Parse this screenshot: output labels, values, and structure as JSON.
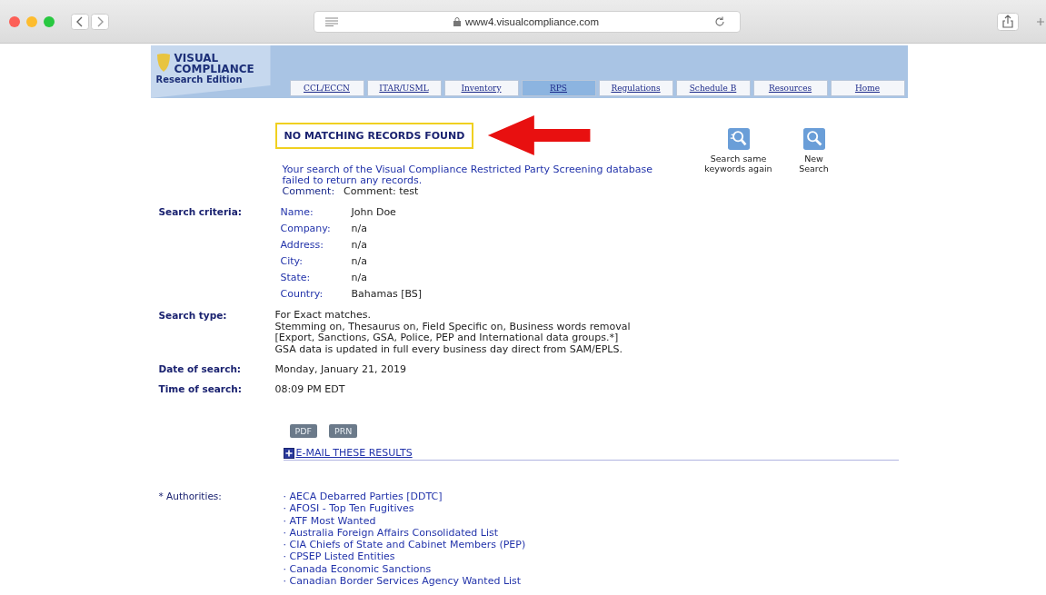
{
  "browser": {
    "url": "www4.visualcompliance.com"
  },
  "logo": {
    "line_1": "VISUAL",
    "line_2": "COMPLIANCE",
    "edition": "Research Edition"
  },
  "tabs": [
    {
      "label": "CCL/ECCN",
      "selected": false
    },
    {
      "label": "ITAR/USML",
      "selected": false
    },
    {
      "label": "Inventory",
      "selected": false
    },
    {
      "label": "RPS",
      "selected": true
    },
    {
      "label": "Regulations",
      "selected": false
    },
    {
      "label": "Schedule B",
      "selected": false
    },
    {
      "label": "Resources",
      "selected": false
    },
    {
      "label": "Home",
      "selected": false
    }
  ],
  "result_banner": "NO MATCHING RECORDS FOUND",
  "actions": [
    {
      "label": "Search same keywords again",
      "kind": "repeat"
    },
    {
      "label": "New Search",
      "kind": "new"
    }
  ],
  "message": "Your search of the Visual Compliance Restricted Party Screening database failed to return any records.",
  "comment": {
    "label": "Comment:",
    "value": "Comment: test"
  },
  "search_criteria": {
    "label": "Search criteria:",
    "fields": [
      {
        "label": "Name:",
        "value": "John Doe"
      },
      {
        "label": "Company:",
        "value": "n/a"
      },
      {
        "label": "Address:",
        "value": "n/a"
      },
      {
        "label": "City:",
        "value": "n/a"
      },
      {
        "label": "State:",
        "value": "n/a"
      },
      {
        "label": "Country:",
        "value": "Bahamas [BS]"
      }
    ]
  },
  "search_type": {
    "label": "Search type:",
    "lines": [
      "For Exact matches.",
      "Stemming on, Thesaurus on, Field Specific on, Business words removal",
      "[Export, Sanctions, GSA, Police, PEP and International data groups.*]",
      "GSA data is updated in full every business day direct from SAM/EPLS."
    ]
  },
  "date_of_search": {
    "label": "Date of search:",
    "value": "Monday, January 21, 2019"
  },
  "time_of_search": {
    "label": "Time of search:",
    "value": "08:09 PM EDT"
  },
  "export_buttons": [
    "PDF",
    "PRN"
  ],
  "email_link": "E-MAIL THESE RESULTS",
  "authorities": {
    "label": "* Authorities:",
    "items": [
      "· AECA Debarred Parties [DDTC]",
      "· AFOSI - Top Ten Fugitives",
      "· ATF Most Wanted",
      "· Australia Foreign Affairs Consolidated List",
      "· CIA Chiefs of State and Cabinet Members (PEP)",
      "· CPSEP Listed Entities",
      "· Canada Economic Sanctions",
      "· Canadian Border Services Agency Wanted List"
    ]
  }
}
